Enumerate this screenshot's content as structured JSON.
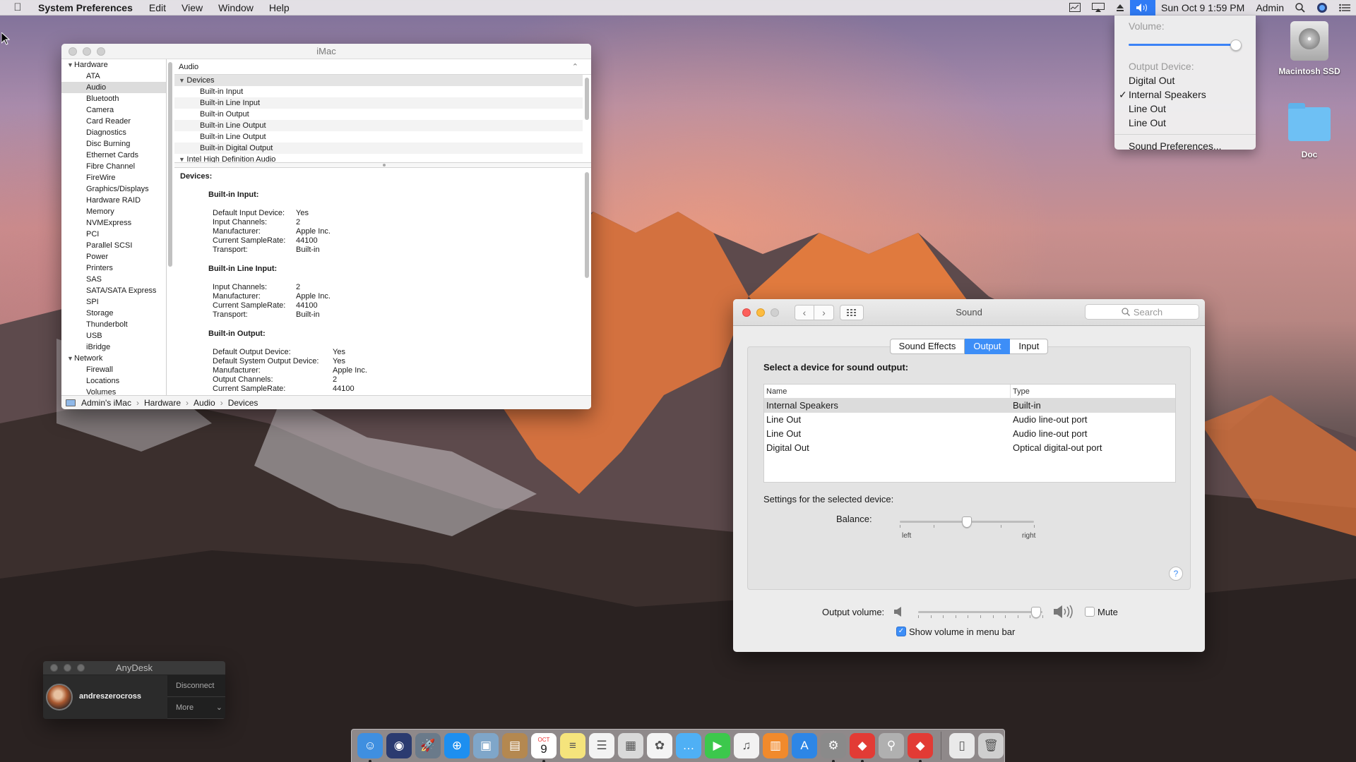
{
  "menubar": {
    "app_name": "System Preferences",
    "menus": [
      "Edit",
      "View",
      "Window",
      "Help"
    ],
    "clock": "Sun Oct 9  1:59 PM",
    "user": "Admin"
  },
  "volume_menu": {
    "volume_label": "Volume:",
    "volume_level": 1.0,
    "output_label": "Output Device:",
    "devices": [
      "Digital Out",
      "Internal Speakers",
      "Line Out",
      "Line Out"
    ],
    "checked_device": "Internal Speakers",
    "check_mark": "✓",
    "prefs_label": "Sound Preferences..."
  },
  "desktop": {
    "icons": [
      "Macintosh SSD",
      "Doc"
    ]
  },
  "sysinfo": {
    "title": "iMac",
    "sidebar": [
      {
        "label": "Hardware",
        "group": true
      },
      {
        "label": "ATA"
      },
      {
        "label": "Audio",
        "selected": true
      },
      {
        "label": "Bluetooth"
      },
      {
        "label": "Camera"
      },
      {
        "label": "Card Reader"
      },
      {
        "label": "Diagnostics"
      },
      {
        "label": "Disc Burning"
      },
      {
        "label": "Ethernet Cards"
      },
      {
        "label": "Fibre Channel"
      },
      {
        "label": "FireWire"
      },
      {
        "label": "Graphics/Displays"
      },
      {
        "label": "Hardware RAID"
      },
      {
        "label": "Memory"
      },
      {
        "label": "NVMExpress"
      },
      {
        "label": "PCI"
      },
      {
        "label": "Parallel SCSI"
      },
      {
        "label": "Power"
      },
      {
        "label": "Printers"
      },
      {
        "label": "SAS"
      },
      {
        "label": "SATA/SATA Express"
      },
      {
        "label": "SPI"
      },
      {
        "label": "Storage"
      },
      {
        "label": "Thunderbolt"
      },
      {
        "label": "USB"
      },
      {
        "label": "iBridge"
      },
      {
        "label": "Network",
        "group": true
      },
      {
        "label": "Firewall"
      },
      {
        "label": "Locations"
      },
      {
        "label": "Volumes"
      }
    ],
    "table_header": "Audio",
    "table_rows": [
      {
        "label": "Devices",
        "group": true
      },
      {
        "label": "Built-in Input"
      },
      {
        "label": "Built-in Line Input"
      },
      {
        "label": "Built-in Output"
      },
      {
        "label": "Built-in Line Output"
      },
      {
        "label": "Built-in Line Output"
      },
      {
        "label": "Built-in Digital Output"
      },
      {
        "label": "Intel High Definition Audio",
        "group": true
      }
    ],
    "detail": {
      "heading": "Devices:",
      "sections": [
        {
          "title": "Built-in Input:",
          "wide": false,
          "fields": [
            [
              "Default Input Device:",
              "Yes"
            ],
            [
              "Input Channels:",
              "2"
            ],
            [
              "Manufacturer:",
              "Apple Inc."
            ],
            [
              "Current SampleRate:",
              "44100"
            ],
            [
              "Transport:",
              "Built-in"
            ]
          ]
        },
        {
          "title": "Built-in Line Input:",
          "wide": false,
          "fields": [
            [
              "Input Channels:",
              "2"
            ],
            [
              "Manufacturer:",
              "Apple Inc."
            ],
            [
              "Current SampleRate:",
              "44100"
            ],
            [
              "Transport:",
              "Built-in"
            ]
          ]
        },
        {
          "title": "Built-in Output:",
          "wide": true,
          "fields": [
            [
              "Default Output Device:",
              "Yes"
            ],
            [
              "Default System Output Device:",
              "Yes"
            ],
            [
              "Manufacturer:",
              "Apple Inc."
            ],
            [
              "Output Channels:",
              "2"
            ],
            [
              "Current SampleRate:",
              "44100"
            ]
          ]
        }
      ]
    },
    "path": [
      "Admin's iMac",
      "Hardware",
      "Audio",
      "Devices"
    ],
    "path_sep": "›"
  },
  "sound": {
    "title": "Sound",
    "search_placeholder": "Search",
    "tabs": [
      {
        "label": "Sound Effects",
        "active": false
      },
      {
        "label": "Output",
        "active": true
      },
      {
        "label": "Input",
        "active": false
      }
    ],
    "select_label": "Select a device for sound output:",
    "columns": [
      "Name",
      "Type"
    ],
    "devices": [
      {
        "name": "Internal Speakers",
        "type": "Built-in",
        "selected": true
      },
      {
        "name": "Line Out",
        "type": "Audio line-out port"
      },
      {
        "name": "Line Out",
        "type": "Audio line-out port"
      },
      {
        "name": "Digital Out",
        "type": "Optical digital-out port"
      }
    ],
    "settings_label": "Settings for the selected device:",
    "balance_label": "Balance:",
    "balance_left": "left",
    "balance_right": "right",
    "balance_value": 0.5,
    "help": "?",
    "output_volume_label": "Output volume:",
    "output_volume": 0.95,
    "mute_label": "Mute",
    "mute_checked": false,
    "show_volume_label": "Show volume in menu bar",
    "show_volume_checked": true
  },
  "anydesk": {
    "title": "AnyDesk",
    "user": "andreszerocross",
    "disconnect": "Disconnect",
    "more": "More"
  },
  "dock": {
    "calendar_month": "OCT",
    "calendar_day": "9",
    "apps": [
      {
        "name": "finder-icon",
        "color": "#3f8fe0"
      },
      {
        "name": "siri-icon",
        "color": "#2b3b70"
      },
      {
        "name": "launchpad-icon",
        "color": "#6a7a8a"
      },
      {
        "name": "safari-icon",
        "color": "#1d8ff0"
      },
      {
        "name": "preview-icon",
        "color": "#7fa6c9"
      },
      {
        "name": "contacts-icon",
        "color": "#b48850"
      },
      {
        "name": "calendar-icon",
        "color": "#ffffff"
      },
      {
        "name": "notes-icon",
        "color": "#f5e47c"
      },
      {
        "name": "reminders-icon",
        "color": "#f3f3f3"
      },
      {
        "name": "photo-booth-icon",
        "color": "#d9d9d9"
      },
      {
        "name": "photos-icon",
        "color": "#f4f4f4"
      },
      {
        "name": "messages-icon",
        "color": "#4fb0f5"
      },
      {
        "name": "facetime-icon",
        "color": "#3cc84c"
      },
      {
        "name": "itunes-icon",
        "color": "#f2f2f2"
      },
      {
        "name": "ibooks-icon",
        "color": "#f18a2c"
      },
      {
        "name": "app-store-icon",
        "color": "#2d86e6"
      },
      {
        "name": "system-preferences-icon",
        "color": "#8a8a8a"
      },
      {
        "name": "anydesk-icon",
        "color": "#e23b35"
      },
      {
        "name": "utility-icon",
        "color": "#b0b0b0"
      },
      {
        "name": "anydesk-alt-icon",
        "color": "#e23b35"
      }
    ],
    "trailing": [
      {
        "name": "documents-stack-icon",
        "color": "#e9e9e9"
      },
      {
        "name": "trash-icon",
        "color": "#cfcfcf"
      }
    ]
  }
}
